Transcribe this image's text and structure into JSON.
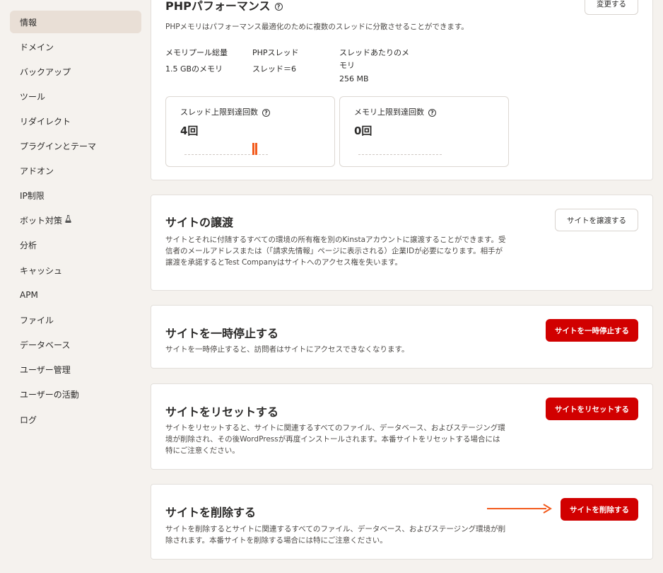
{
  "sidebar": {
    "items": [
      {
        "label": "情報"
      },
      {
        "label": "ドメイン"
      },
      {
        "label": "バックアップ"
      },
      {
        "label": "ツール"
      },
      {
        "label": "リダイレクト"
      },
      {
        "label": "プラグインとテーマ"
      },
      {
        "label": "アドオン"
      },
      {
        "label": "IP制限"
      },
      {
        "label": "ボット対策"
      },
      {
        "label": "分析"
      },
      {
        "label": "キャッシュ"
      },
      {
        "label": "APM"
      },
      {
        "label": "ファイル"
      },
      {
        "label": "データベース"
      },
      {
        "label": "ユーザー管理"
      },
      {
        "label": "ユーザーの活動"
      },
      {
        "label": "ログ"
      }
    ],
    "active_index": 0,
    "bot_icon": "flask-icon"
  },
  "php": {
    "title": "PHPパフォーマンス",
    "change_button": "変更する",
    "description": "PHPメモリはパフォーマンス最適化のために複数のスレッドに分散させることができます。",
    "pool_label": "メモリプール総量",
    "pool_value": "1.5 GBのメモリ",
    "threads_label": "PHPスレッド",
    "threads_value": "スレッド＝6",
    "per_thread_label_1": "スレッドあたりのメ",
    "per_thread_label_2": "モリ",
    "per_thread_value": "256 MB",
    "thread_limit_title": "スレッド上限到達回数",
    "thread_limit_value": "4回",
    "memory_limit_title": "メモリ上限到達回数",
    "memory_limit_value": "0回"
  },
  "transfer": {
    "title": "サイトの譲渡",
    "button": "サイトを譲渡する",
    "line1": "サイトとそれに付随するすべての環境の所有権を別のKinstaアカウントに譲渡することができます。受",
    "line2": "信者のメールアドレスまたは（「請求先情報」ページに表示される）企業IDが必要になります。相手が",
    "line3": "譲渡を承諾するとTest Companyはサイトへのアクセス権を失います。"
  },
  "pause": {
    "title": "サイトを一時停止する",
    "button": "サイトを一時停止する",
    "line1": "サイトを一時停止すると、訪問者はサイトにアクセスできなくなります。"
  },
  "reset": {
    "title": "サイトをリセットする",
    "button": "サイトをリセットする",
    "line1": "サイトをリセットすると、サイトに関連するすべてのファイル、データベース、およびステージング環",
    "line2": "境が削除され、その後WordPressが再度インストールされます。本番サイトをリセットする場合には",
    "line3": "特にご注意ください。"
  },
  "delete": {
    "title": "サイトを削除する",
    "button": "サイトを削除する",
    "line1": "サイトを削除するとサイトに関連するすべてのファイル、データベース、およびステージング環境が削",
    "line2": "除されます。本番サイトを削除する場合には特にご注意ください。"
  },
  "colors": {
    "danger": "#d10000",
    "arrow": "#f25a1c",
    "active_nav": "#e9dfd6"
  }
}
